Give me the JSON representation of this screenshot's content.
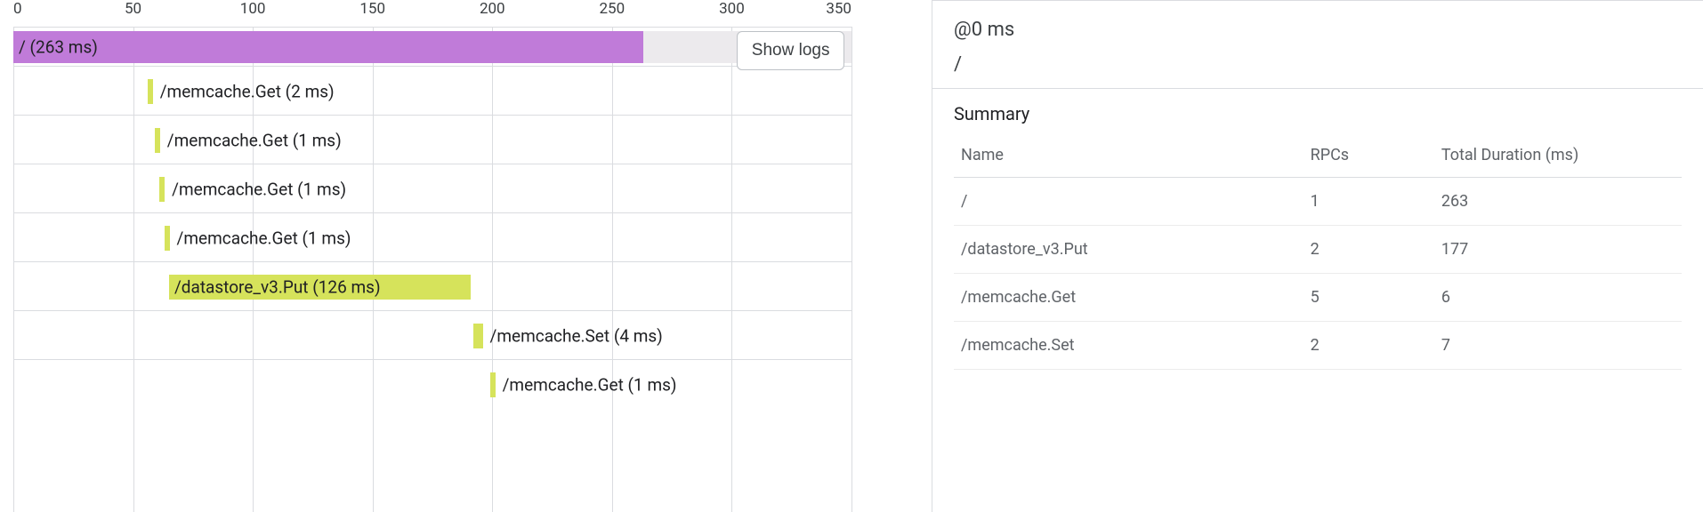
{
  "axis": {
    "max_ms": 350,
    "ticks": [
      0,
      50,
      100,
      150,
      200,
      250,
      300,
      350
    ]
  },
  "main_span": {
    "label": "/ (263 ms)",
    "start_ms": 0,
    "duration_ms": 263
  },
  "child_spans": [
    {
      "label": "/memcache.Get (2 ms)",
      "start_ms": 56,
      "duration_ms": 2,
      "label_inside": false
    },
    {
      "label": "/memcache.Get (1 ms)",
      "start_ms": 59,
      "duration_ms": 1,
      "label_inside": false
    },
    {
      "label": "/memcache.Get (1 ms)",
      "start_ms": 61,
      "duration_ms": 1,
      "label_inside": false
    },
    {
      "label": "/memcache.Get (1 ms)",
      "start_ms": 63,
      "duration_ms": 1,
      "label_inside": false
    },
    {
      "label": "/datastore_v3.Put (126 ms)",
      "start_ms": 65,
      "duration_ms": 126,
      "label_inside": true
    },
    {
      "label": "/memcache.Set (4 ms)",
      "start_ms": 192,
      "duration_ms": 4,
      "label_inside": false
    },
    {
      "label": "/memcache.Get (1 ms)",
      "start_ms": 199,
      "duration_ms": 1,
      "label_inside": false
    }
  ],
  "show_logs_label": "Show logs",
  "panel": {
    "time": "@0 ms",
    "path": "/",
    "title": "Summary",
    "columns": [
      "Name",
      "RPCs",
      "Total Duration (ms)"
    ],
    "rows": [
      {
        "name": "/",
        "rpcs": "1",
        "total": "263"
      },
      {
        "name": "/datastore_v3.Put",
        "rpcs": "2",
        "total": "177"
      },
      {
        "name": "/memcache.Get",
        "rpcs": "5",
        "total": "6"
      },
      {
        "name": "/memcache.Set",
        "rpcs": "2",
        "total": "7"
      }
    ]
  },
  "chart_data": {
    "type": "bar",
    "title": "Trace waterfall",
    "xlabel": "ms",
    "ylabel": "",
    "xlim": [
      0,
      350
    ],
    "series": [
      {
        "name": "/",
        "start": 0,
        "duration": 263
      },
      {
        "name": "/memcache.Get",
        "start": 56,
        "duration": 2
      },
      {
        "name": "/memcache.Get",
        "start": 59,
        "duration": 1
      },
      {
        "name": "/memcache.Get",
        "start": 61,
        "duration": 1
      },
      {
        "name": "/memcache.Get",
        "start": 63,
        "duration": 1
      },
      {
        "name": "/datastore_v3.Put",
        "start": 65,
        "duration": 126
      },
      {
        "name": "/memcache.Set",
        "start": 192,
        "duration": 4
      },
      {
        "name": "/memcache.Get",
        "start": 199,
        "duration": 1
      }
    ]
  }
}
